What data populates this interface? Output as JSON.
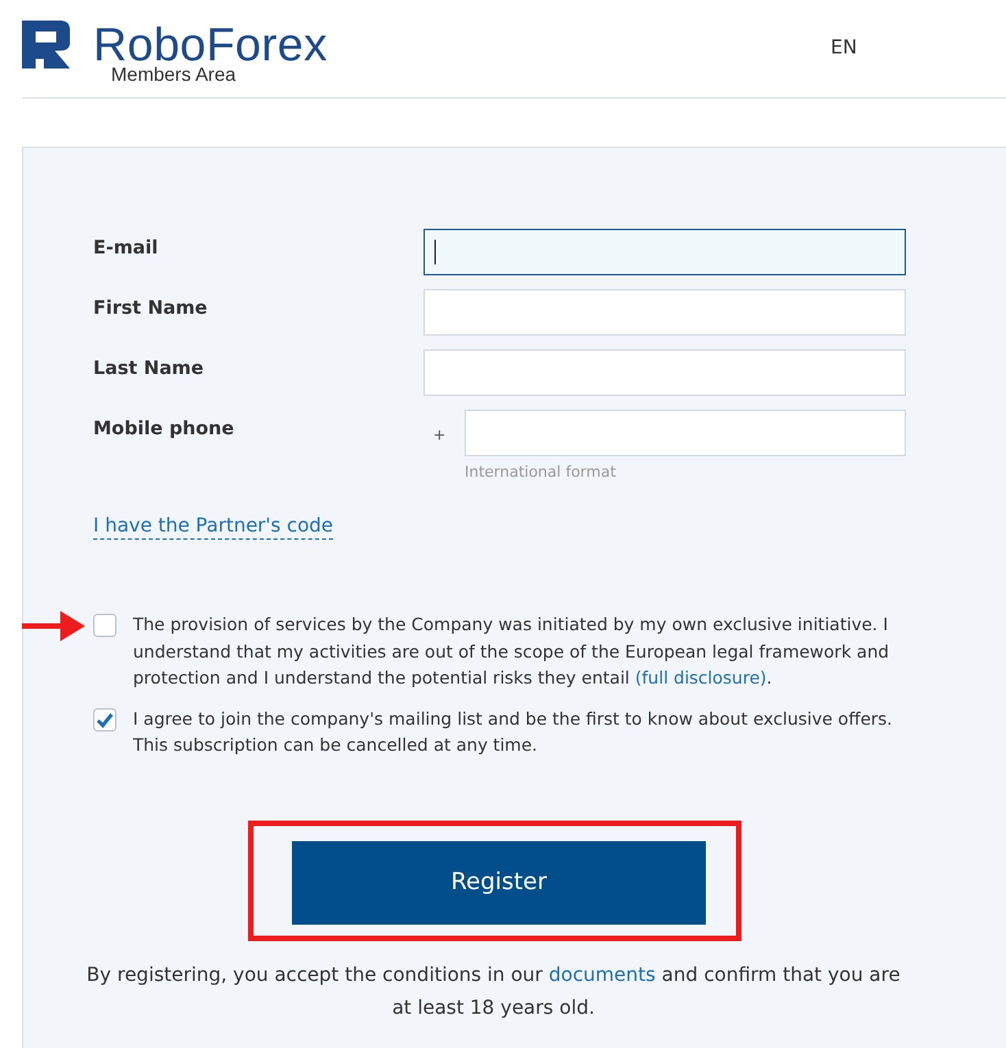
{
  "header": {
    "brand": "RoboForex",
    "subtitle": "Members Area",
    "language": "EN"
  },
  "form": {
    "fields": [
      {
        "label": "E-mail",
        "kind": "text",
        "focused": true
      },
      {
        "label": "First Name",
        "kind": "text",
        "focused": false
      },
      {
        "label": "Last Name",
        "kind": "text",
        "focused": false
      },
      {
        "label": "Mobile phone",
        "kind": "phone",
        "focused": false,
        "prefix": "+",
        "hint": "International format"
      }
    ],
    "partner_link": "I have the Partner's code",
    "agreements": [
      {
        "text_before": "The provision of services by the Company was initiated by my own exclusive initiative. I understand that my activities are out of the scope of the European legal framework and protection and I understand the potential risks they entail ",
        "link": "(full disclosure)",
        "text_after": ".",
        "checked": false,
        "annotated": true
      },
      {
        "text_before": "I agree to join the company's mailing list and be the first to know about exclusive offers. This subscription can be cancelled at any time.",
        "checked": true,
        "annotated": false
      }
    ],
    "submit": {
      "label": "Register",
      "highlighted": true
    },
    "footnote": {
      "text_before": "By registering, you accept the conditions in our ",
      "link": "documents",
      "text_after": " and confirm that you are at least 18 years old."
    }
  }
}
